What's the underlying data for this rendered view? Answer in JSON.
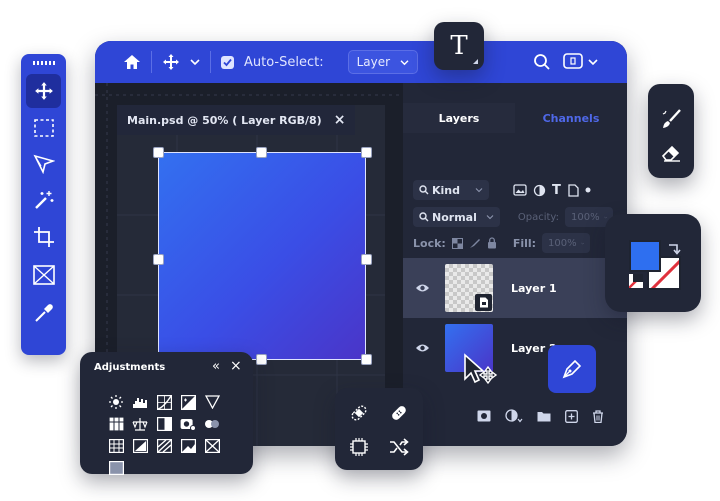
{
  "topbar": {
    "auto_select_label": "Auto-Select:",
    "auto_select_value": "Layer",
    "icons": [
      "home-icon",
      "move-icon",
      "chevron-down-icon",
      "search-icon",
      "frame-icon"
    ]
  },
  "document": {
    "tab_title": "Main.psd @ 50% ( Layer RGB/8)",
    "close_glyph": "×"
  },
  "layers_panel": {
    "tabs": [
      "Layers",
      "Channels"
    ],
    "filter_label": "Kind",
    "blend_mode": "Normal",
    "opacity_label": "Opacity:",
    "opacity_value": "100%",
    "lock_label": "Lock:",
    "fill_label": "Fill:",
    "fill_value": "100%",
    "layers": [
      {
        "name": "Layer 1",
        "selected": true
      },
      {
        "name": "Layer 2",
        "selected": false
      }
    ]
  },
  "type_tool": {
    "glyph": "T"
  },
  "adjustments": {
    "title": "Adjustments",
    "collapse_glyph": "«",
    "close_glyph": "×"
  },
  "colors": {
    "accent": "#2f46d6",
    "panel": "#222738",
    "foreground": "#2e6ff0",
    "background": "#ffffff"
  }
}
